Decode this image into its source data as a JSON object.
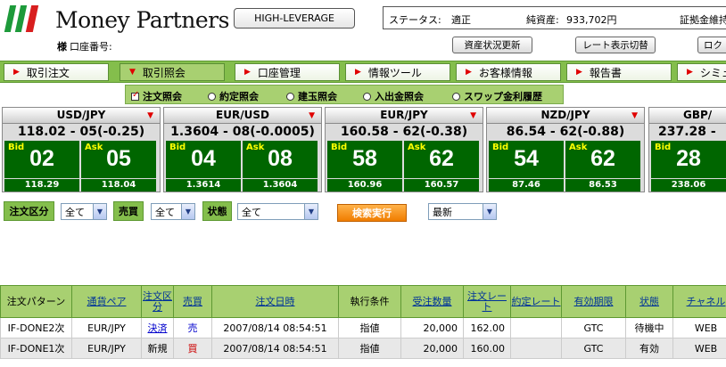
{
  "brand": {
    "name": "Money Partners",
    "colors": [
      "#1d9a3a",
      "#1d9a3a",
      "#d81e1e"
    ]
  },
  "account": {
    "honorific": "様",
    "number_label": "口座番号:"
  },
  "header": {
    "leverage_button": "HIGH-LEVERAGE",
    "status_label": "ステータス:",
    "status_value": "適正",
    "net_assets_label": "純資産:",
    "net_assets_value": "933,702円",
    "margin_label": "証拠金維持",
    "refresh_button": "資産状況更新",
    "rate_display_button": "レート表示切替",
    "logout_button": "ロク"
  },
  "nav": {
    "tabs": [
      {
        "label": "取引注文",
        "active": false
      },
      {
        "label": "取引照会",
        "active": true
      },
      {
        "label": "口座管理",
        "active": false
      },
      {
        "label": "情報ツール",
        "active": false
      },
      {
        "label": "お客様情報",
        "active": false
      },
      {
        "label": "報告書",
        "active": false
      },
      {
        "label": "シミュ",
        "active": false
      }
    ],
    "sub_items": [
      {
        "label": "注文照会",
        "checked": true
      },
      {
        "label": "約定照会",
        "checked": false
      },
      {
        "label": "建玉照会",
        "checked": false
      },
      {
        "label": "入出金照会",
        "checked": false
      },
      {
        "label": "スワップ金利履歴",
        "checked": false
      }
    ]
  },
  "rates": [
    {
      "pair": "USD/JPY",
      "quote": "118.02 - 05(-0.25)",
      "bid": "02",
      "ask": "05",
      "bid_high": "118.29",
      "ask_low": "118.04"
    },
    {
      "pair": "EUR/USD",
      "quote": "1.3604 - 08(-0.0005)",
      "bid": "04",
      "ask": "08",
      "bid_high": "1.3614",
      "ask_low": "1.3604"
    },
    {
      "pair": "EUR/JPY",
      "quote": "160.58 - 62(-0.38)",
      "bid": "58",
      "ask": "62",
      "bid_high": "160.96",
      "ask_low": "160.57"
    },
    {
      "pair": "NZD/JPY",
      "quote": "86.54 - 62(-0.88)",
      "bid": "54",
      "ask": "62",
      "bid_high": "87.46",
      "ask_low": "86.53"
    },
    {
      "pair": "GBP/",
      "quote": "237.28 -",
      "bid": "28",
      "ask": "",
      "bid_high": "238.06",
      "ask_low": ""
    }
  ],
  "bid_label": "Bid",
  "ask_label": "Ask",
  "filters": {
    "order_type_label": "注文区分",
    "order_type_value": "全て",
    "side_label": "売買",
    "side_value": "全て",
    "state_label": "状態",
    "state_value": "全て",
    "search_button": "検索実行",
    "sort_value": "最新"
  },
  "table": {
    "headers": [
      "注文パターン",
      "通貨ペア",
      "注文区分",
      "売買",
      "注文日時",
      "執行条件",
      "受注数量",
      "注文レート",
      "約定レート",
      "有効期限",
      "状態",
      "チャネル"
    ],
    "rows": [
      [
        "IF-DONE2次",
        "EUR/JPY",
        "決済",
        "売",
        "2007/08/14 08:54:51",
        "指値",
        "20,000",
        "162.00",
        "",
        "GTC",
        "待機中",
        "WEB"
      ],
      [
        "IF-DONE1次",
        "EUR/JPY",
        "新規",
        "買",
        "2007/08/14 08:54:51",
        "指値",
        "20,000",
        "160.00",
        "",
        "GTC",
        "有効",
        "WEB"
      ]
    ]
  }
}
